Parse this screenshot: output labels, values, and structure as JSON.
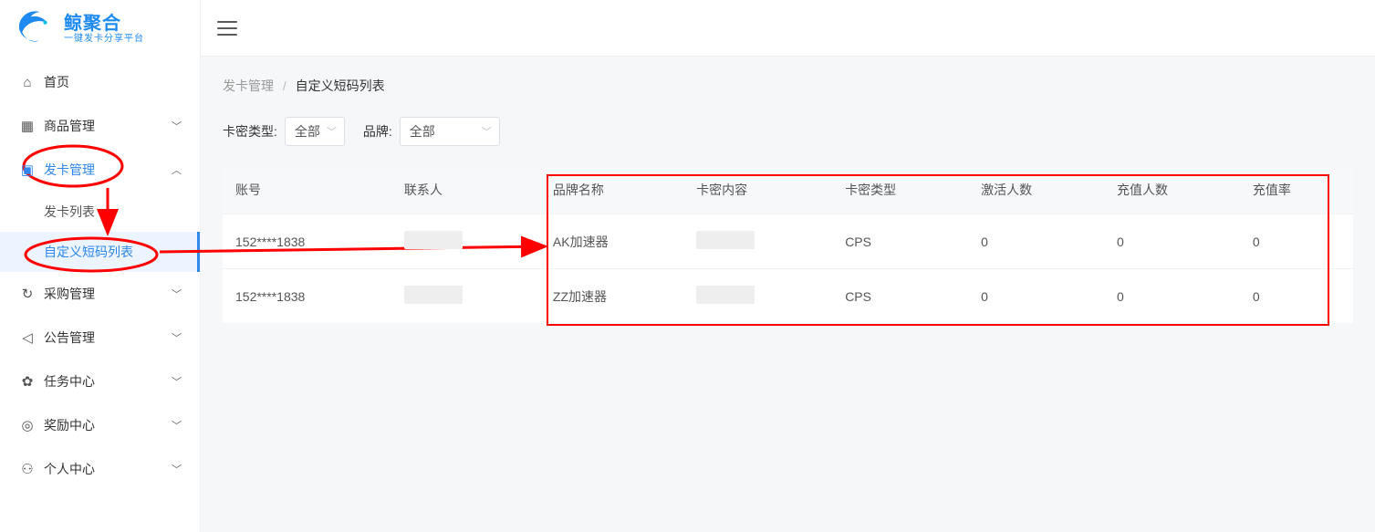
{
  "brand": {
    "name": "鲸聚合",
    "tagline": "一键发卡分享平台"
  },
  "sidebar": {
    "items": [
      {
        "label": "首页",
        "icon": "home",
        "children": []
      },
      {
        "label": "商品管理",
        "icon": "grid",
        "children": [],
        "collapsed": true
      },
      {
        "label": "发卡管理",
        "icon": "card",
        "expanded": true,
        "active": true,
        "children": [
          {
            "label": "发卡列表",
            "active": false
          },
          {
            "label": "自定义短码列表",
            "active": true
          }
        ]
      },
      {
        "label": "采购管理",
        "icon": "refresh",
        "collapsed": true
      },
      {
        "label": "公告管理",
        "icon": "megaphone",
        "collapsed": true
      },
      {
        "label": "任务中心",
        "icon": "gift",
        "collapsed": true
      },
      {
        "label": "奖励中心",
        "icon": "coin",
        "collapsed": true
      },
      {
        "label": "个人中心",
        "icon": "user",
        "collapsed": true
      }
    ]
  },
  "breadcrumb": {
    "parent": "发卡管理",
    "current": "自定义短码列表"
  },
  "filters": {
    "type_label": "卡密类型:",
    "type_selected": "全部",
    "brand_label": "品牌:",
    "brand_selected": "全部"
  },
  "table": {
    "headers": {
      "account": "账号",
      "contact": "联系人",
      "brand_name": "品牌名称",
      "card_content": "卡密内容",
      "card_type": "卡密类型",
      "activated": "激活人数",
      "recharged": "充值人数",
      "rate": "充值率"
    },
    "rows": [
      {
        "account": "152****1838",
        "contact": "",
        "brand_name": "AK加速器",
        "card_content": "",
        "card_type": "CPS",
        "activated": "0",
        "recharged": "0",
        "rate": "0"
      },
      {
        "account": "152****1838",
        "contact": "",
        "brand_name": "ZZ加速器",
        "card_content": "",
        "card_type": "CPS",
        "activated": "0",
        "recharged": "0",
        "rate": "0"
      }
    ]
  },
  "annotations": {
    "color": "#ff0000"
  }
}
